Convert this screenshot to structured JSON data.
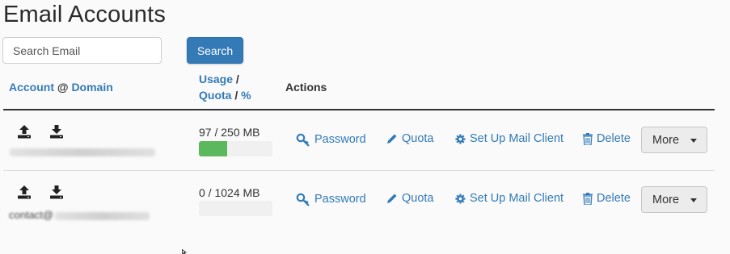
{
  "page": {
    "title": "Email Accounts"
  },
  "search": {
    "placeholder": "Search Email",
    "button_label": "Search"
  },
  "table": {
    "headers": {
      "account": "Account",
      "at": "@",
      "domain": "Domain",
      "usage": "Usage",
      "slash1": "/",
      "quota": "Quota",
      "slash2": "/",
      "percent": "%",
      "actions": "Actions"
    },
    "rows": [
      {
        "account_partial": "contact@",
        "usage_text": "97 / 250 MB",
        "usage_fraction": 0.388,
        "actions": {
          "password": "Password",
          "quota": "Quota",
          "setup": "Set Up Mail Client",
          "delete": "Delete",
          "more": "More"
        }
      },
      {
        "account_partial": "contact@",
        "usage_text": "0 / 1024 MB",
        "usage_fraction": 0,
        "actions": {
          "password": "Password",
          "quota": "Quota",
          "setup": "Set Up Mail Client",
          "delete": "Delete",
          "more": "More"
        }
      }
    ]
  },
  "colors": {
    "link": "#337ab7",
    "primary": "#337ab7",
    "progress": "#5cb85c"
  },
  "icons": [
    "upload-icon",
    "download-icon",
    "key-icon",
    "pencil-icon",
    "gear-icon",
    "trash-icon",
    "caret-down-icon"
  ]
}
